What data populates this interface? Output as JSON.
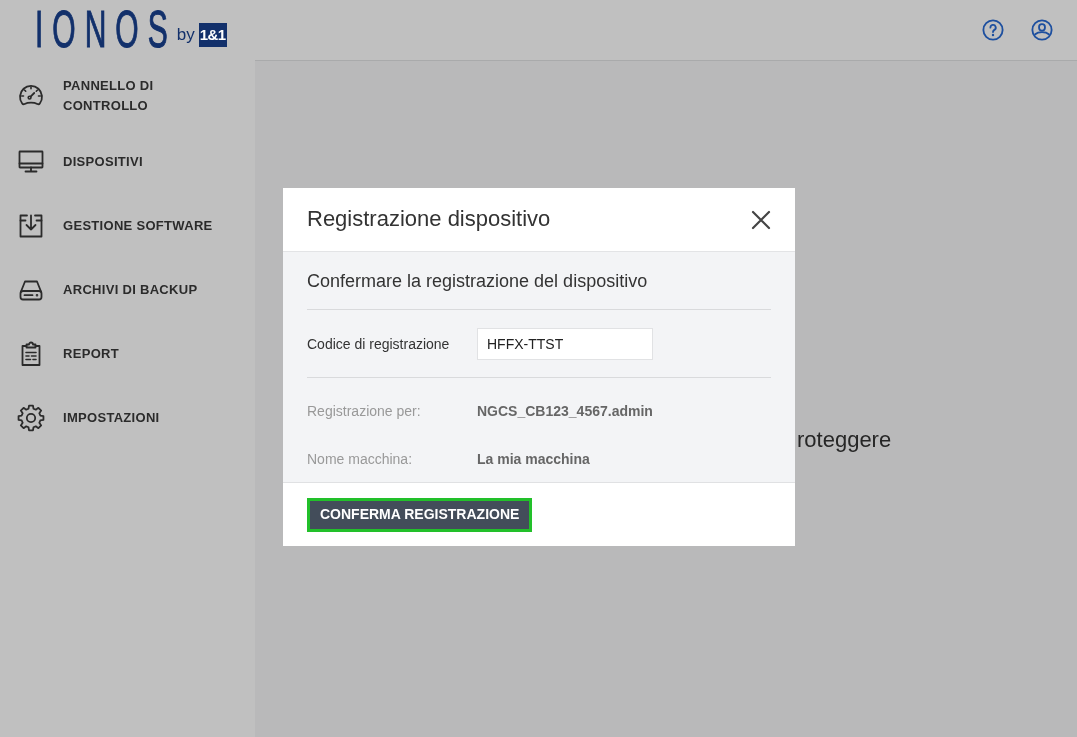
{
  "header": {
    "logo": {
      "wordmark": "IONOS",
      "by": "by",
      "tile": "1&1"
    }
  },
  "sidebar": {
    "items": [
      {
        "label": "PANNELLO DI CONTROLLO"
      },
      {
        "label": "DISPOSITIVI"
      },
      {
        "label": "GESTIONE SOFTWARE"
      },
      {
        "label": "ARCHIVI DI BACKUP"
      },
      {
        "label": "REPORT"
      },
      {
        "label": "IMPOSTAZIONI"
      }
    ]
  },
  "main": {
    "text": "roteggere"
  },
  "dialog": {
    "title": "Registrazione dispositivo",
    "subtitle": "Confermare la registrazione del dispositivo",
    "fields": [
      {
        "kind": "input",
        "label": "Codice di registrazione",
        "value": "HFFX-TTST"
      },
      {
        "kind": "static",
        "label": "Registrazione per:",
        "value": "NGCS_CB123_4567.admin"
      },
      {
        "kind": "static",
        "label": "Nome macchina:",
        "value": "La mia macchina"
      }
    ],
    "button": {
      "label": "CONFERMA REGISTRAZIONE",
      "focused": true
    }
  }
}
